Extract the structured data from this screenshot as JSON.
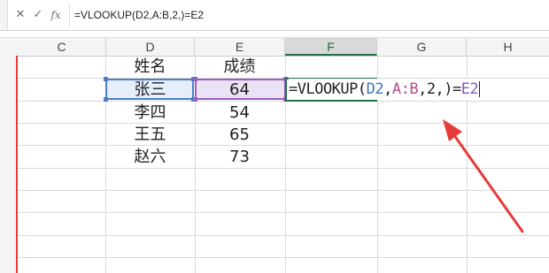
{
  "formula_bar": {
    "cancel_icon": "x-icon",
    "confirm_icon": "check-icon",
    "fx_label": "fx",
    "formula": "=VLOOKUP(D2,A:B,2,)=E2"
  },
  "columns": [
    "C",
    "D",
    "E",
    "F",
    "G",
    "H"
  ],
  "active_column": "F",
  "table": {
    "header_name": "姓名",
    "header_score": "成绩",
    "rows": [
      {
        "name": "张三",
        "score": "64"
      },
      {
        "name": "李四",
        "score": "54"
      },
      {
        "name": "王五",
        "score": "65"
      },
      {
        "name": "赵六",
        "score": "73"
      }
    ]
  },
  "editing_formula": {
    "prefix": "=VLOOKUP(",
    "ref1": "D2",
    "comma1": ",",
    "ref2": "A:B",
    "mid": ",2,)=",
    "ref3": "E2"
  },
  "colors": {
    "accent_green": "#217346",
    "ref_blue": "#3c72c2",
    "ref_purple": "#8a55c0",
    "arrow_red": "#e53b3b"
  }
}
